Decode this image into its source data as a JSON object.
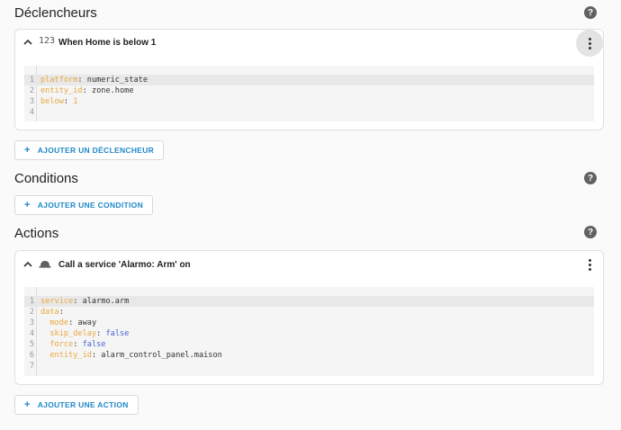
{
  "sections": {
    "triggers": {
      "title": "Déclencheurs",
      "card": {
        "type_icon": "123",
        "title": "When Home is below 1",
        "code": [
          {
            "key": "platform",
            "sep": ": ",
            "val": "numeric_state",
            "vtype": "plain"
          },
          {
            "key": "entity_id",
            "sep": ": ",
            "val": "zone.home",
            "vtype": "plain"
          },
          {
            "key": "below",
            "sep": ": ",
            "val": "1",
            "vtype": "num"
          },
          {
            "key": "",
            "sep": "",
            "val": "",
            "vtype": "plain"
          }
        ]
      },
      "add_label": "AJOUTER UN DÉCLENCHEUR"
    },
    "conditions": {
      "title": "Conditions",
      "add_label": "AJOUTER UNE CONDITION"
    },
    "actions": {
      "title": "Actions",
      "card": {
        "title": "Call a service 'Alarmo: Arm' on",
        "code": [
          {
            "key": "service",
            "sep": ": ",
            "val": "alarmo.arm",
            "vtype": "plain",
            "indent": 0
          },
          {
            "key": "data",
            "sep": ":",
            "val": "",
            "vtype": "plain",
            "indent": 0
          },
          {
            "key": "mode",
            "sep": ": ",
            "val": "away",
            "vtype": "plain",
            "indent": 1
          },
          {
            "key": "skip_delay",
            "sep": ": ",
            "val": "false",
            "vtype": "bool",
            "indent": 1
          },
          {
            "key": "force",
            "sep": ": ",
            "val": "false",
            "vtype": "bool",
            "indent": 1
          },
          {
            "key": "entity_id",
            "sep": ": ",
            "val": "alarm_control_panel.maison",
            "vtype": "plain",
            "indent": 1
          },
          {
            "key": "",
            "sep": "",
            "val": "",
            "vtype": "plain",
            "indent": 0
          }
        ]
      },
      "add_label": "AJOUTER UNE ACTION"
    }
  },
  "help_glyph": "?",
  "plus_glyph": "+",
  "colors": {
    "accent": "#1e88c8",
    "yaml_key": "#e8a83e",
    "yaml_bool": "#4a5fd6"
  }
}
